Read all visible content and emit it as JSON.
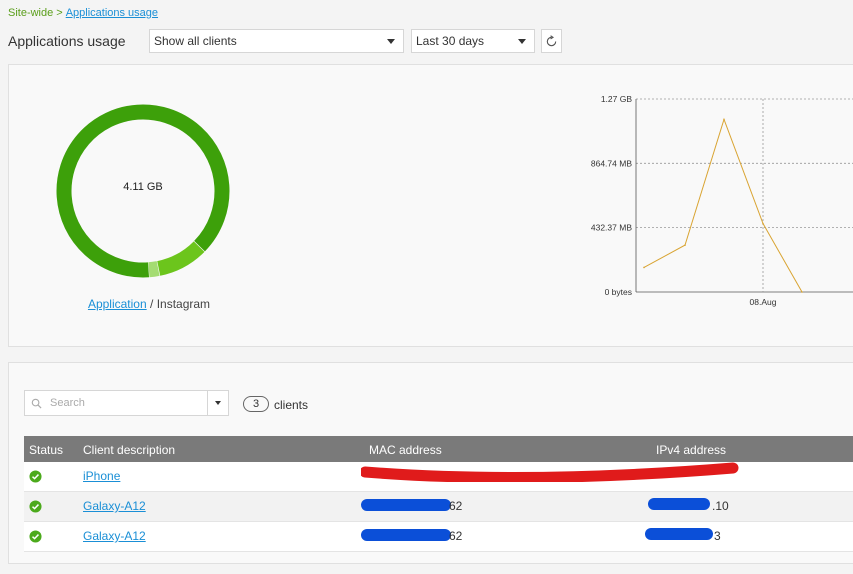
{
  "breadcrumb": {
    "root": "Site-wide",
    "separator": ">",
    "current": "Applications usage"
  },
  "page_title": "Applications usage",
  "client_filter": {
    "selected": "Show all clients"
  },
  "range_filter": {
    "selected": "Last 30 days"
  },
  "donut": {
    "total": "4.11 GB",
    "caption_link": "Application",
    "caption_sep": "/",
    "caption_app": "Instagram",
    "segments": [
      {
        "fraction": 0.885,
        "color": "#3da00a"
      },
      {
        "fraction": 0.095,
        "color": "#6cc51c"
      },
      {
        "fraction": 0.02,
        "color": "#a4dc72"
      }
    ]
  },
  "chart_data": {
    "type": "line",
    "y_ticks": [
      "0 bytes",
      "432.37 MB",
      "864.74 MB",
      "1.27 GB"
    ],
    "x_ticks": [
      "08.Aug"
    ],
    "y_max_mb": 1297,
    "series": [
      {
        "color": "#d9a432",
        "values_mb": [
          165,
          315,
          1160,
          460,
          0
        ]
      }
    ]
  },
  "search": {
    "placeholder": "Search"
  },
  "client_count": {
    "value": "3",
    "label": "clients"
  },
  "table": {
    "headers": {
      "status": "Status",
      "description": "Client description",
      "mac": "MAC address",
      "ipv4": "IPv4 address"
    },
    "rows": [
      {
        "description": "iPhone",
        "mac_suffix": "",
        "ip_suffix": ""
      },
      {
        "description": "Galaxy-A12",
        "mac_suffix": "62",
        "ip_suffix": ".10"
      },
      {
        "description": "Galaxy-A12",
        "mac_suffix": "62",
        "ip_suffix": "3"
      }
    ]
  },
  "colors": {
    "accent_link": "#1a8fd6",
    "status_ok": "#4caa1c",
    "redaction_red": "#e01b1b",
    "redaction_blue": "#0b4fd8"
  }
}
